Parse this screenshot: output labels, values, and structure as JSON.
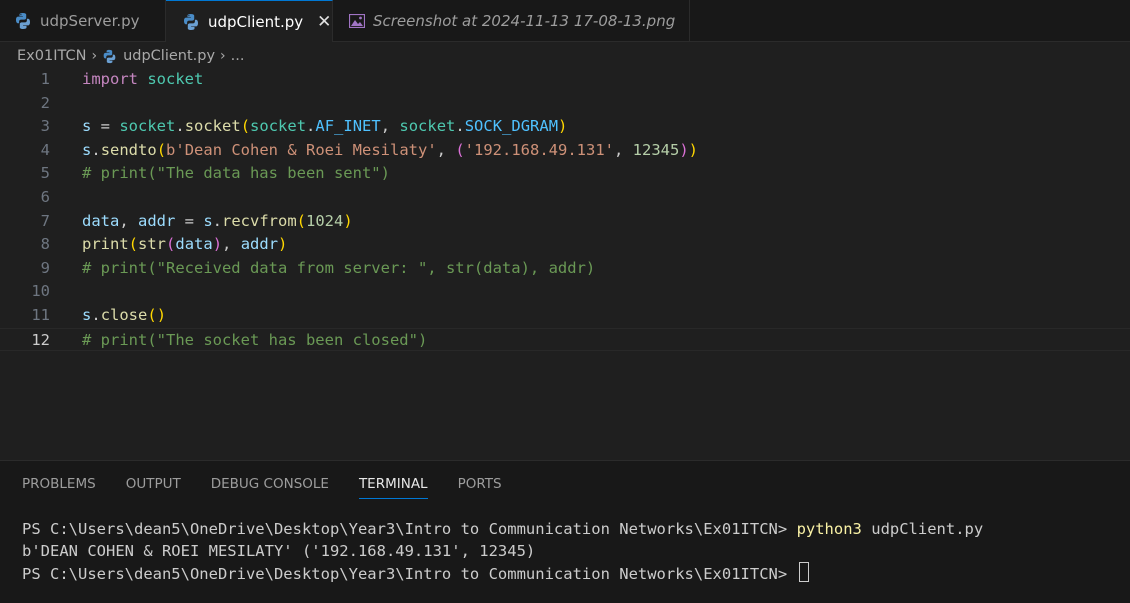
{
  "tabs": [
    {
      "label": "udpServer.py",
      "icon": "python-icon"
    },
    {
      "label": "udpClient.py",
      "icon": "python-icon",
      "close": "✕"
    },
    {
      "label": "Screenshot at 2024-11-13 17-08-13.png",
      "icon": "image-icon"
    }
  ],
  "breadcrumb": {
    "folder": "Ex01ITCN",
    "file": "udpClient.py",
    "more": "..."
  },
  "editor": {
    "current_line": 12,
    "lines": [
      {
        "n": "1",
        "text": "import socket"
      },
      {
        "n": "2",
        "text": ""
      },
      {
        "n": "3",
        "text": "s = socket.socket(socket.AF_INET, socket.SOCK_DGRAM)"
      },
      {
        "n": "4",
        "text": "s.sendto(b'Dean Cohen & Roei Mesilaty', ('192.168.49.131', 12345))"
      },
      {
        "n": "5",
        "text": "# print(\"The data has been sent\")"
      },
      {
        "n": "6",
        "text": ""
      },
      {
        "n": "7",
        "text": "data, addr = s.recvfrom(1024)"
      },
      {
        "n": "8",
        "text": "print(str(data), addr)"
      },
      {
        "n": "9",
        "text": "# print(\"Received data from server: \", str(data), addr)"
      },
      {
        "n": "10",
        "text": ""
      },
      {
        "n": "11",
        "text": "s.close()"
      },
      {
        "n": "12",
        "text": "# print(\"The socket has been closed\")"
      }
    ]
  },
  "panel": {
    "tabs": [
      "PROBLEMS",
      "OUTPUT",
      "DEBUG CONSOLE",
      "TERMINAL",
      "PORTS"
    ],
    "active": "TERMINAL"
  },
  "terminal": {
    "prompt": "PS C:\\Users\\dean5\\OneDrive\\Desktop\\Year3\\Intro to Communication Networks\\Ex01ITCN>",
    "command_name": "python3",
    "command_args": "udpClient.py",
    "output": "b'DEAN COHEN & ROEI MESILATY' ('192.168.49.131', 12345)"
  },
  "colors": {
    "accent": "#0078d4",
    "editor_bg": "#1f1f1f",
    "panel_bg": "#181818"
  }
}
